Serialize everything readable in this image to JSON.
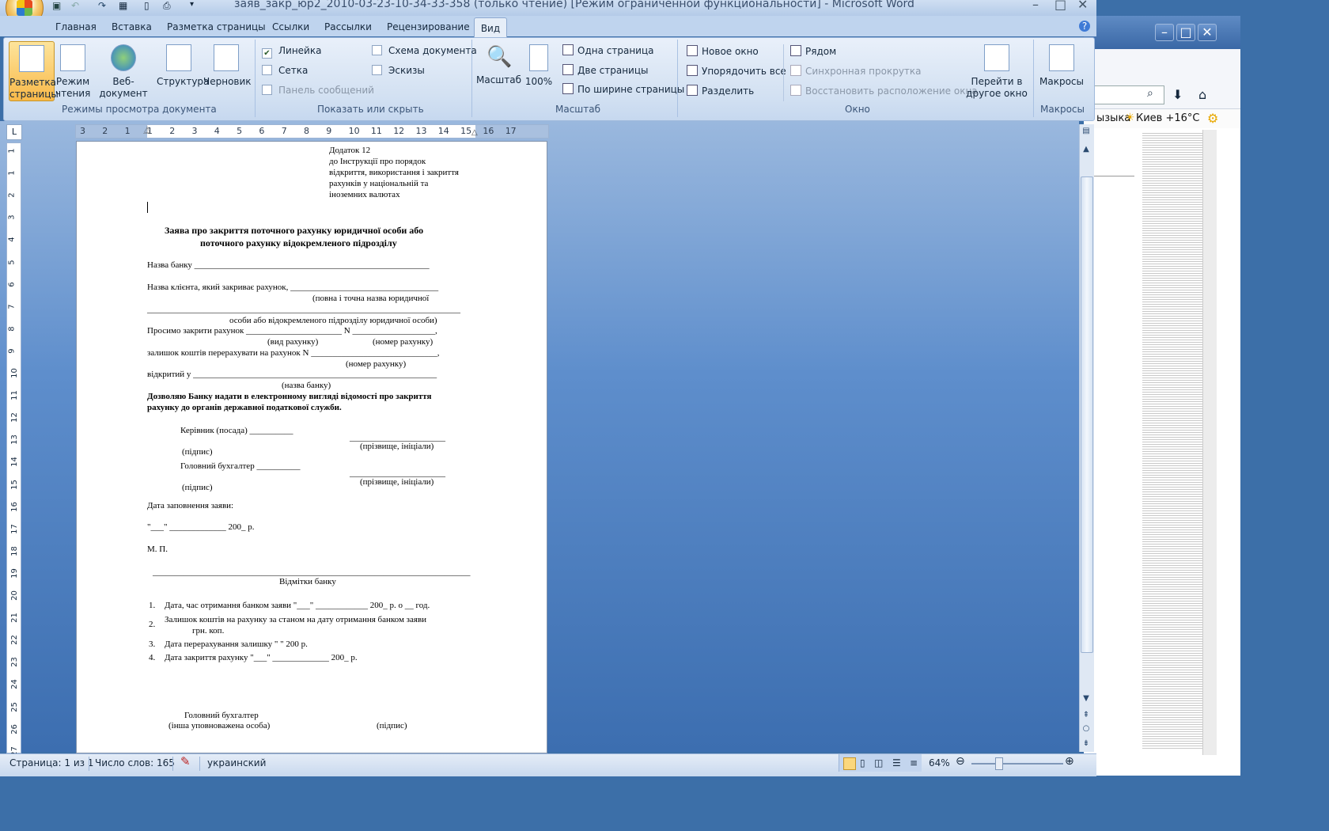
{
  "window": {
    "title": "заяв_закр_юр2_2010-03-23-10-34-33-358 (только чтение) [Режим ограниченной функциональности] - Microsoft Word"
  },
  "tabs": [
    "Главная",
    "Вставка",
    "Разметка страницы",
    "Ссылки",
    "Рассылки",
    "Рецензирование",
    "Вид"
  ],
  "ribbon": {
    "views_group": {
      "label": "Режимы просмотра документа",
      "buttons": [
        "Разметка страницы",
        "Режим чтения",
        "Веб-документ",
        "Структура",
        "Черновик"
      ]
    },
    "show_hide_group": {
      "label": "Показать или скрыть",
      "ruler": "Линейка",
      "grid": "Сетка",
      "message_bar": "Панель сообщений",
      "doc_map": "Схема документа",
      "thumbnails": "Эскизы"
    },
    "zoom_group": {
      "label": "Масштаб",
      "zoom": "Масштаб",
      "percent": "100%",
      "one_page": "Одна страница",
      "two_pages": "Две страницы",
      "page_width": "По ширине страницы"
    },
    "window_group": {
      "label": "Окно",
      "new_window": "Новое окно",
      "arrange_all": "Упорядочить все",
      "split": "Разделить",
      "side_by_side": "Рядом",
      "sync_scroll": "Синхронная прокрутка",
      "reset_position": "Восстановить расположение окна",
      "switch_windows": "Перейти в другое окно"
    },
    "macros_group": {
      "label": "Макросы",
      "macros": "Макросы"
    }
  },
  "ruler": {
    "corner": "L",
    "ticks": [
      "3",
      "2",
      "1",
      "1",
      "2",
      "3",
      "4",
      "5",
      "6",
      "7",
      "8",
      "9",
      "10",
      "11",
      "12",
      "13",
      "14",
      "15",
      "16",
      "17"
    ],
    "vticks": [
      "1",
      "1",
      "2",
      "3",
      "4",
      "5",
      "6",
      "7",
      "8",
      "9",
      "10",
      "11",
      "12",
      "13",
      "14",
      "15",
      "16",
      "17",
      "18",
      "19",
      "20",
      "21",
      "22",
      "23",
      "24",
      "25",
      "26",
      "27"
    ]
  },
  "document": {
    "appendix": [
      "Додаток 12",
      "до Інструкції про порядок",
      "відкриття, використання і закриття",
      "рахунків у національній та",
      "іноземних валютах"
    ],
    "heading1": "Заява про закриття поточного рахунку юридичної особи або",
    "heading2": "поточного рахунку відокремленого підрозділу",
    "bank_name": "Назва банку ______________________________________________________",
    "client_line": "Назва клієнта, який закриває рахунок, __________________________________",
    "client_hint1": "(повна і точна назва юридичної",
    "client_blank": "________________________________________________________________________",
    "client_hint2": "особи або відокремленого підрозділу юридичної особи)",
    "request_line": "Просимо закрити рахунок ______________________ N ___________________,",
    "account_type_hint": "(вид рахунку)",
    "account_number_hint": "(номер рахунку)",
    "balance_line": "залишок коштів перерахувати на рахунок N _____________________________,",
    "balance_hint": "(номер рахунку)",
    "opened_line": "відкритий у ________________________________________________________",
    "bank_hint": "(назва банку)",
    "consent1": "Дозволяю Банку надати в електронному вигляді відомості про закриття",
    "consent2": "рахунку до органів державної податкової служби.",
    "head_line": "Керівник (посада) __________",
    "sign_blank": "______________________",
    "surname_hint": "(прізвище, ініціали)",
    "sign_hint": "(підпис)",
    "accountant_line": "Головний бухгалтер __________",
    "date_label": "Дата заповнення заяви:",
    "date_line": "\"___\" _____________ 200_ р.",
    "stamp": "М. П.",
    "separator": "_________________________________________________________________________",
    "bank_marks": "Відмітки банку",
    "items": [
      "Дата, час отримання банком заяви \"___\" ____________ 200_ р. о __ год.",
      "Залишок коштів на рахунку за станом на дату отримання банком заяви",
      "Дата перерахування залишку \"       \"                       200   р.",
      "Дата закриття рахунку \"___\" _____________ 200_ р."
    ],
    "item2_cont": "грн.            коп.",
    "footer_title": "Головний бухгалтер",
    "footer_hint": "(інша уповноважена особа)",
    "footer_sign": "(підпис)"
  },
  "status_bar": {
    "page": "Страница: 1 из 1",
    "words": "Число слов: 165",
    "language": "украинский",
    "zoom": "64%"
  },
  "background_window": {
    "links_text": "ызыка",
    "weather": "Киев +16°C"
  }
}
